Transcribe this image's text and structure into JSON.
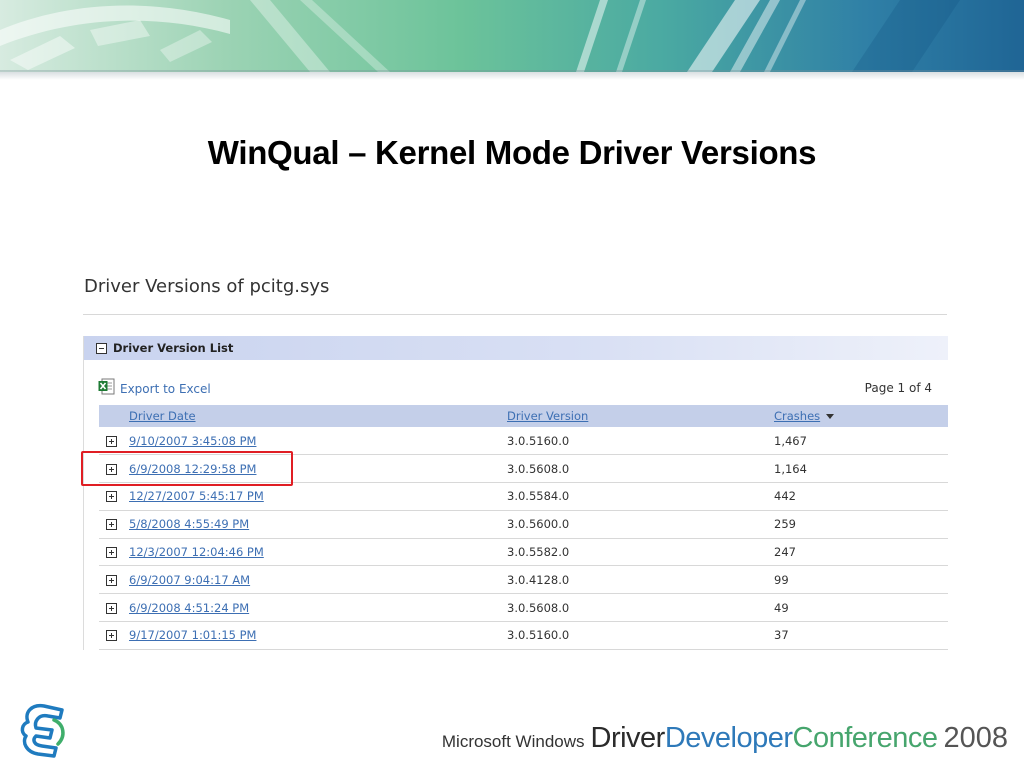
{
  "slide": {
    "title": "WinQual – Kernel Mode Driver Versions"
  },
  "page": {
    "heading": "Driver Versions of pcitg.sys"
  },
  "panel": {
    "title": "Driver Version List",
    "export_label": "Export to Excel",
    "pager": "Page 1 of 4"
  },
  "table": {
    "columns": {
      "date": "Driver Date",
      "version": "Driver Version",
      "crashes": "Crashes"
    },
    "sort": {
      "column": "crashes",
      "direction": "descending"
    },
    "rows": [
      {
        "date": "9/10/2007 3:45:08 PM",
        "version": "3.0.5160.0",
        "crashes": "1,467"
      },
      {
        "date": "6/9/2008 12:29:58 PM",
        "version": "3.0.5608.0",
        "crashes": "1,164"
      },
      {
        "date": "12/27/2007 5:45:17 PM",
        "version": "3.0.5584.0",
        "crashes": "442"
      },
      {
        "date": "5/8/2008 4:55:49 PM",
        "version": "3.0.5600.0",
        "crashes": "259"
      },
      {
        "date": "12/3/2007 12:04:46 PM",
        "version": "3.0.5582.0",
        "crashes": "247"
      },
      {
        "date": "6/9/2007 9:04:17 AM",
        "version": "3.0.4128.0",
        "crashes": "99"
      },
      {
        "date": "6/9/2008 4:51:24 PM",
        "version": "3.0.5608.0",
        "crashes": "49"
      },
      {
        "date": "9/17/2007 1:01:15 PM",
        "version": "3.0.5160.0",
        "crashes": "37"
      }
    ],
    "highlighted_row": 1
  },
  "footer": {
    "microsoft_windows": "Microsoft Windows",
    "driver": "Driver",
    "developer": "Developer",
    "conference": "Conference",
    "year": "2008"
  },
  "colors": {
    "link": "#3d6fb3",
    "header_bg": "#c4cfe9",
    "highlight_border": "#e01e24",
    "developer_blue": "#2e79b9",
    "conference_green": "#46a56d"
  },
  "icons": {
    "collapse": "minus-box-icon",
    "expand": "plus-box-icon",
    "excel": "excel-icon",
    "sort": "sort-descending-icon",
    "logo": "ddc-logo-icon"
  }
}
